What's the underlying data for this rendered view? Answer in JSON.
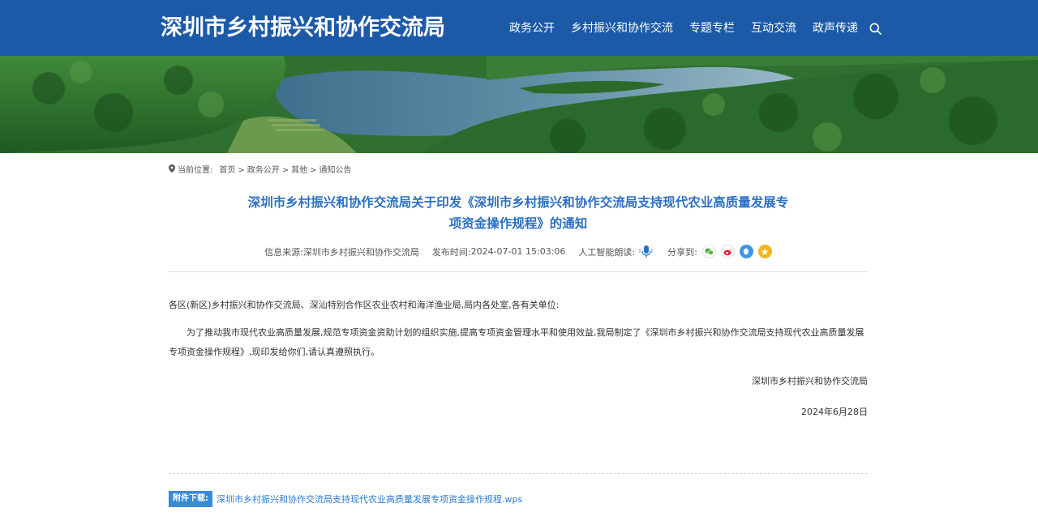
{
  "header": {
    "site_title": "深圳市乡村振兴和协作交流局",
    "nav_items": [
      "政务公开",
      "乡村振兴和协作交流",
      "专题专栏",
      "互动交流",
      "政声传递"
    ],
    "search_icon": "search-icon"
  },
  "breadcrumb": {
    "prefix": "当前位置:",
    "items": [
      "首页",
      "政务公开",
      "其他",
      "通知公告"
    ],
    "separator": ">"
  },
  "article": {
    "title_line1": "深圳市乡村振兴和协作交流局关于印发《深圳市乡村振兴和协作交流局支持现代农业高质量发展专",
    "title_line2": "项资金操作规程》的通知",
    "source_label": "信息来源:",
    "source_value": "深圳市乡村振兴和协作交流局",
    "time_label": "发布时间:",
    "time_value": "2024-07-01 15:03:06",
    "read_label": "人工智能朗读:",
    "share_label": "分享到:",
    "share_icons": [
      "wechat-icon",
      "weibo-icon",
      "qq-icon",
      "qzone-icon"
    ],
    "salutation": "各区(新区)乡村振兴和协作交流局、深汕特别合作区农业农村和海洋渔业局,局内各处室,各有关单位:",
    "paragraph": "为了推动我市现代农业高质量发展,规范专项资金资助计划的组织实施,提高专项资金管理水平和使用效益,我局制定了《深圳市乡村振兴和协作交流局支持现代农业高质量发展专项资金操作规程》,现印发给你们,请认真遵照执行。",
    "signature": "深圳市乡村振兴和协作交流局",
    "date": "2024年6月28日"
  },
  "attachment": {
    "label": "附件下载:",
    "file_name": "深圳市乡村振兴和协作交流局支持现代农业高质量发展专项资金操作规程.wps"
  },
  "colors": {
    "header_bg": "#1c5aa8",
    "title": "#2b6fc2",
    "link": "#2b7ad1",
    "attach_label_bg": "#3a8ad6"
  }
}
